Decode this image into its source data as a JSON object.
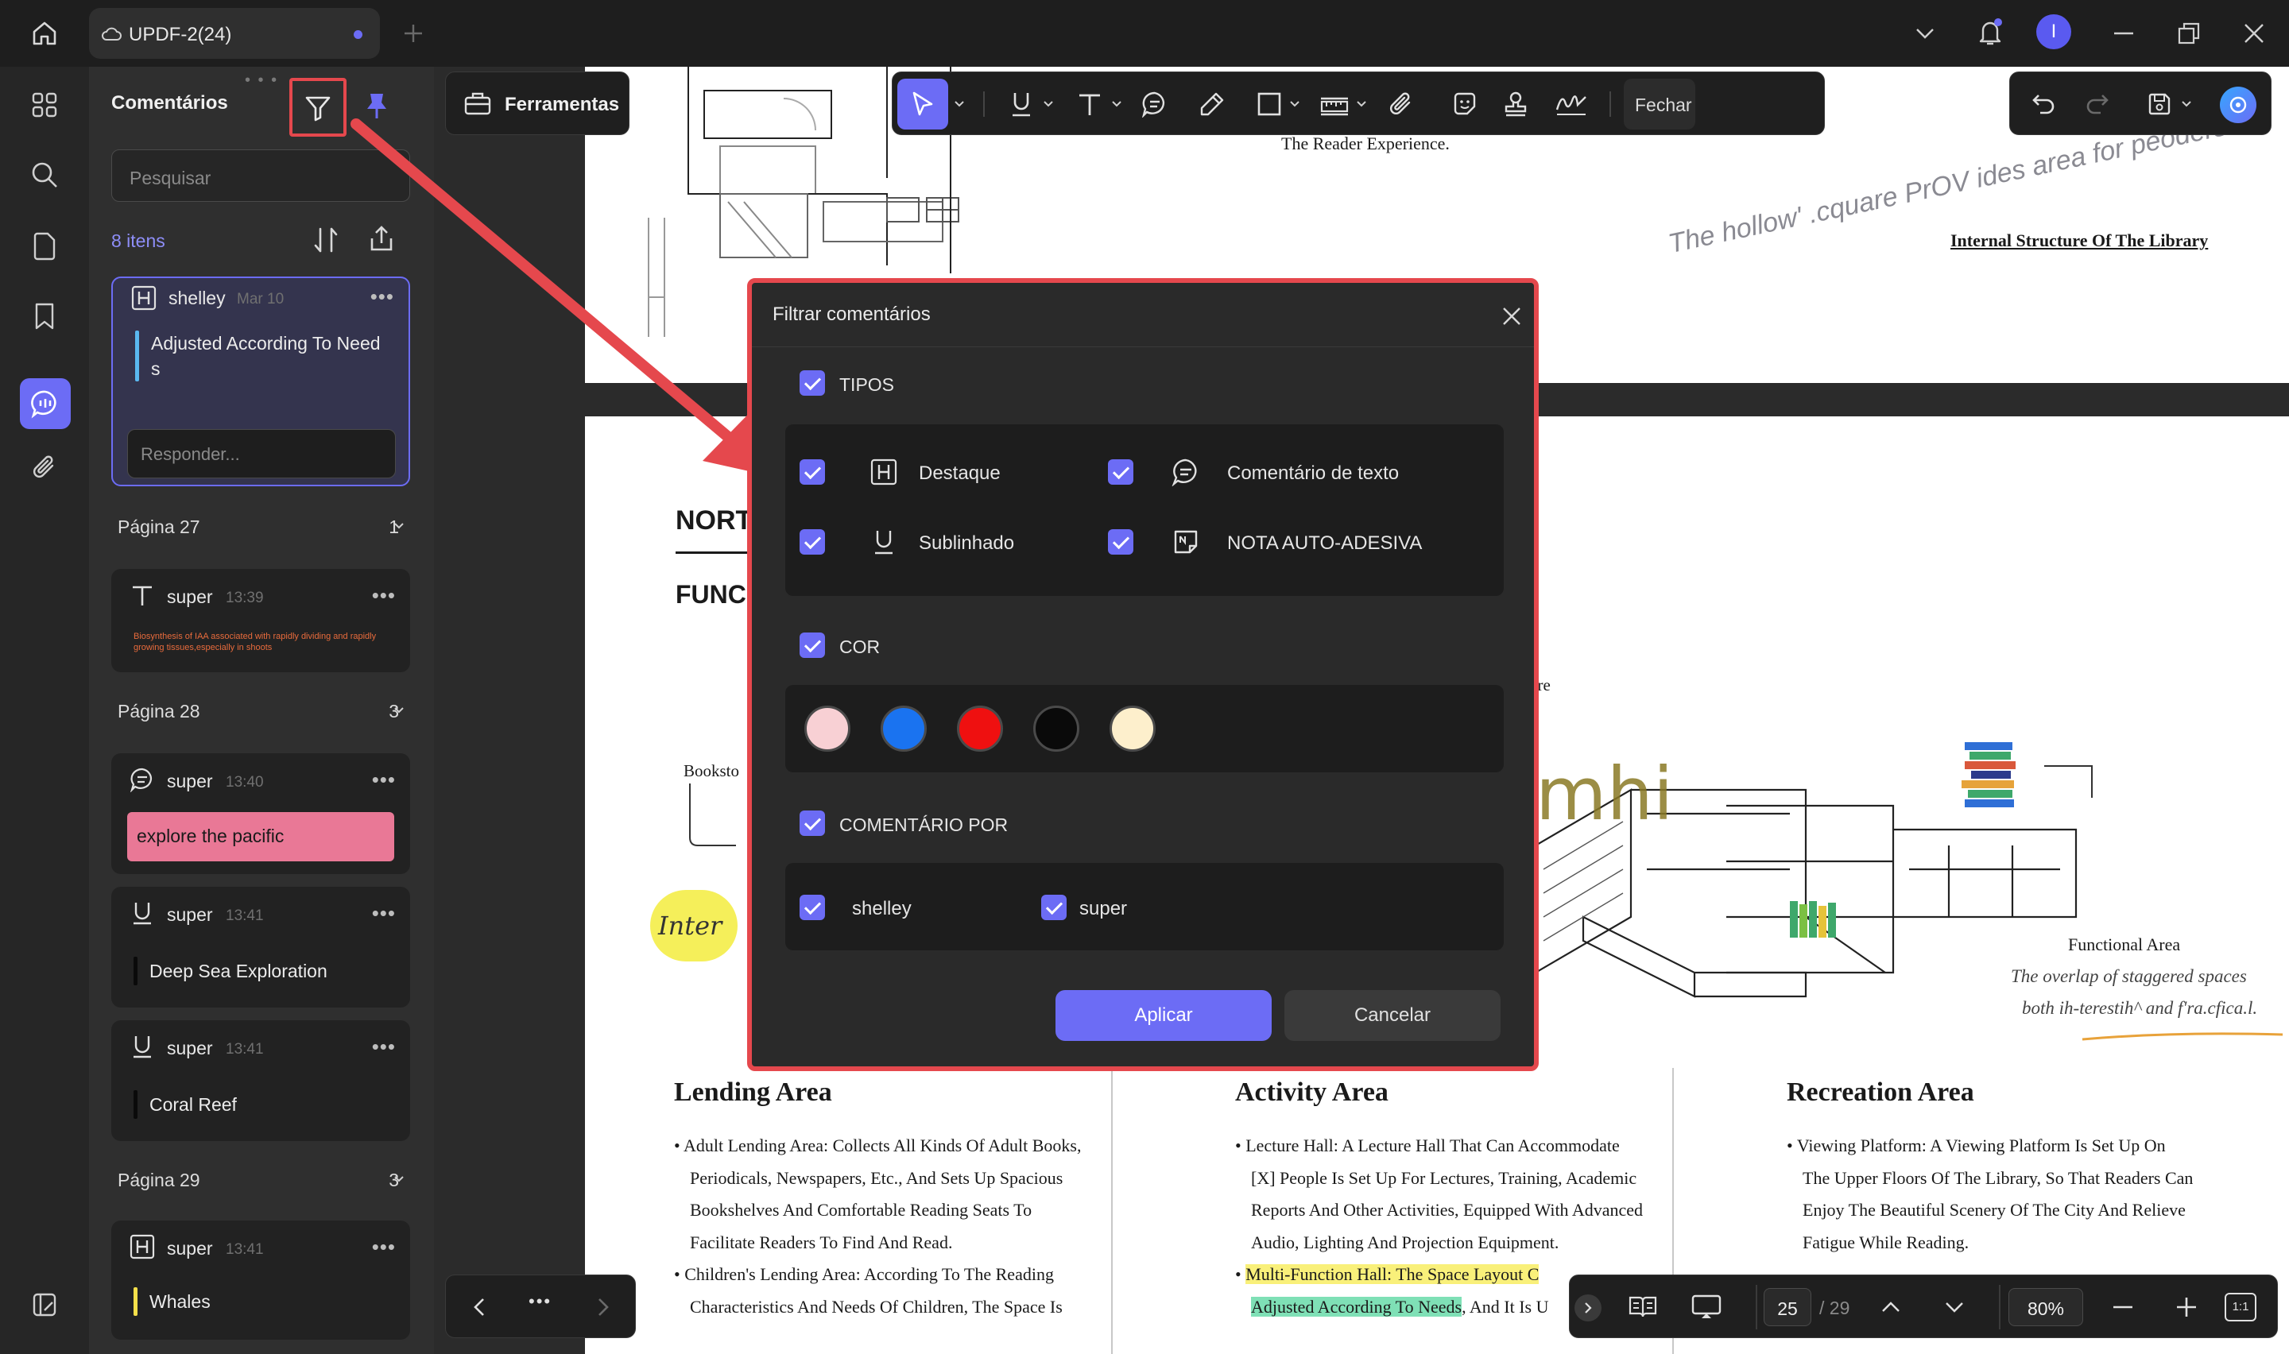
{
  "titlebar": {
    "tab_title": "UPDF-2(24)",
    "avatar_letter": "I"
  },
  "panel": {
    "title": "Comentários",
    "search_placeholder": "Pesquisar",
    "count": "8 itens",
    "selected_card": {
      "author": "shelley",
      "time": "Mar 10",
      "text_line1": "Adjusted According To Need",
      "text_line2": "s",
      "reply_placeholder": "Responder..."
    },
    "groups": [
      {
        "label": "Página 27",
        "count": "1"
      },
      {
        "label": "Página 28",
        "count": "3"
      },
      {
        "label": "Página 29",
        "count": "3"
      }
    ],
    "cards": [
      {
        "author": "super",
        "time": "13:39",
        "text": "Biosynthesis of IAA associated with rapidly dividing and rapidly growing tissues,especially in shoots"
      },
      {
        "author": "super",
        "time": "13:40",
        "text": "explore the pacific"
      },
      {
        "author": "super",
        "time": "13:41",
        "text": "Deep Sea Exploration"
      },
      {
        "author": "super",
        "time": "13:41",
        "text": "Coral Reef"
      },
      {
        "author": "super",
        "time": "13:41",
        "text": "Whales"
      }
    ]
  },
  "toolbar": {
    "tools_label": "Ferramentas",
    "close_label": "Fechar"
  },
  "document": {
    "reader_experience": "The Reader Experience.",
    "internal_structure": "Internal Structure Of The Library",
    "handwriting": "The hollow' .cquare PrOV ides area for peoders",
    "north": "NORT",
    "func": "FUNC",
    "bookstore": "Booksto",
    "ure": "ure",
    "inter": "Inter",
    "functional_area": "Functional Area",
    "overlap_line1": "The overlap of staggered spaces",
    "overlap_line2": "both ih-terestih^ and f'ra.cfica.l.",
    "mhi": "mhi",
    "lending": {
      "title": "Lending Area",
      "items": [
        "Adult Lending Area: Collects All Kinds Of Adult Books,",
        "Periodicals, Newspapers, Etc., And Sets Up Spacious",
        "Bookshelves And Comfortable Reading Seats To",
        "Facilitate Readers To Find And Read.",
        "Children's Lending Area: According To The Reading",
        "Characteristics And Needs Of Children, The Space Is"
      ]
    },
    "activity": {
      "title": "Activity Area",
      "items": [
        "Lecture Hall: A Lecture Hall That Can Accommodate",
        "[X] People Is Set Up For Lectures, Training, Academic",
        "Reports And Other Activities, Equipped With Advanced",
        "Audio, Lighting And Projection Equipment.",
        "Multi-Function Hall: The Space Layout C",
        "Adjusted According To Needs",
        ", And It Is U"
      ]
    },
    "recreation": {
      "title": "Recreation Area",
      "items": [
        "Viewing Platform: A Viewing Platform Is Set Up On",
        "The Upper Floors Of The Library, So That Readers Can",
        "Enjoy The Beautiful Scenery Of The City And Relieve",
        "Fatigue While Reading."
      ]
    }
  },
  "dialog": {
    "title": "Filtrar comentários",
    "types_label": "TIPOS",
    "types": [
      "Destaque",
      "Comentário de texto",
      "Sublinhado",
      "NOTA AUTO-ADESIVA"
    ],
    "color_label": "COR",
    "colors": [
      "#f8d0d4",
      "#1a73f0",
      "#ef1010",
      "#0a0a0a",
      "#fdefcc"
    ],
    "by_label": "COMENTÁRIO POR",
    "authors": [
      "shelley",
      "super"
    ],
    "apply": "Aplicar",
    "cancel": "Cancelar"
  },
  "bottom": {
    "page_current": "25",
    "page_total": "/ 29",
    "zoom": "80%",
    "fit_label": "1:1"
  },
  "colors": {
    "accent": "#6c6cf5",
    "highlight_red": "#e5484d",
    "pink_card": "#e97896"
  }
}
